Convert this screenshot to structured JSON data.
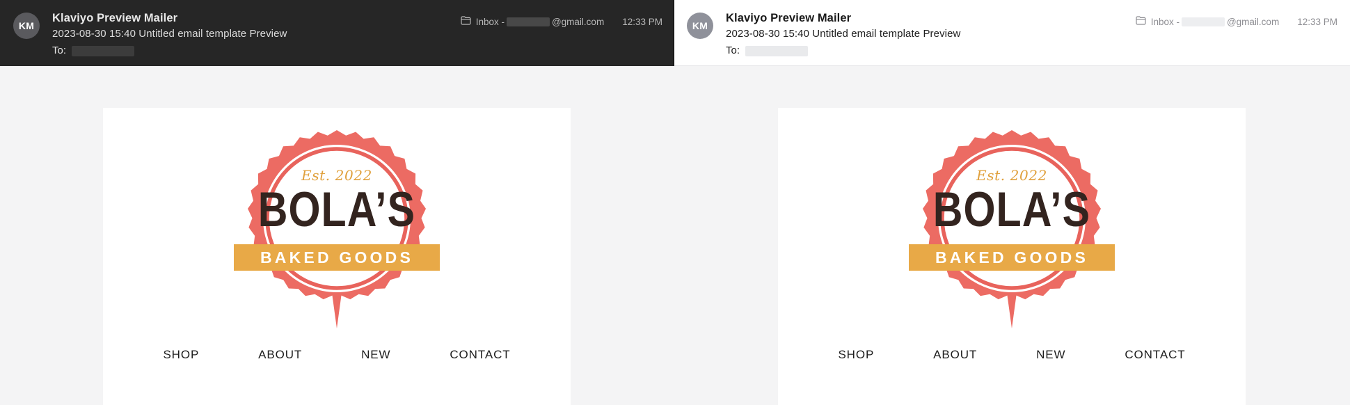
{
  "panels": [
    {
      "id": "left-preview-dark",
      "theme": "dark",
      "header": {
        "avatar_initials": "KM",
        "sender_name": "Klaviyo Preview Mailer",
        "subject_line": "2023-08-30 15:40 Untitled email template Preview",
        "to_label": "To:",
        "to_value_redacted": "",
        "mailbox_icon": "folder-icon",
        "mailbox_prefix": "Inbox -",
        "mailbox_recipient_redacted": "",
        "mailbox_domain": "@gmail.com",
        "time": "12:33 PM"
      },
      "email": {
        "logo": {
          "established": "Est. 2022",
          "brand": "BOLA’S",
          "tagline": "BAKED GOODS"
        },
        "nav": [
          {
            "label": "SHOP"
          },
          {
            "label": "ABOUT"
          },
          {
            "label": "NEW"
          },
          {
            "label": "CONTACT"
          }
        ]
      }
    },
    {
      "id": "right-preview-light",
      "theme": "light",
      "header": {
        "avatar_initials": "KM",
        "sender_name": "Klaviyo Preview Mailer",
        "subject_line": "2023-08-30 15:40 Untitled email template Preview",
        "to_label": "To:",
        "to_value_redacted": "",
        "mailbox_icon": "folder-icon",
        "mailbox_prefix": "Inbox -",
        "mailbox_recipient_redacted": "",
        "mailbox_domain": "@gmail.com",
        "time": "12:33 PM"
      },
      "email": {
        "logo": {
          "established": "Est. 2022",
          "brand": "BOLA’S",
          "tagline": "BAKED GOODS"
        },
        "nav": [
          {
            "label": "SHOP"
          },
          {
            "label": "ABOUT"
          },
          {
            "label": "NEW"
          },
          {
            "label": "CONTACT"
          }
        ]
      }
    }
  ],
  "colors": {
    "dark_header_bg": "#262626",
    "light_header_bg": "#ffffff",
    "body_bg": "#f4f4f5",
    "card_bg": "#ffffff",
    "logo_coral": "#ec6b63",
    "logo_coral_ring": "#e8635c",
    "logo_gold": "#e8a947",
    "logo_gold_text": "#e0a03c",
    "logo_dark_text": "#33241f",
    "nav_text": "#1d1d1d",
    "avatar_dark": "#5a5a5e",
    "avatar_light": "#8f919a"
  }
}
